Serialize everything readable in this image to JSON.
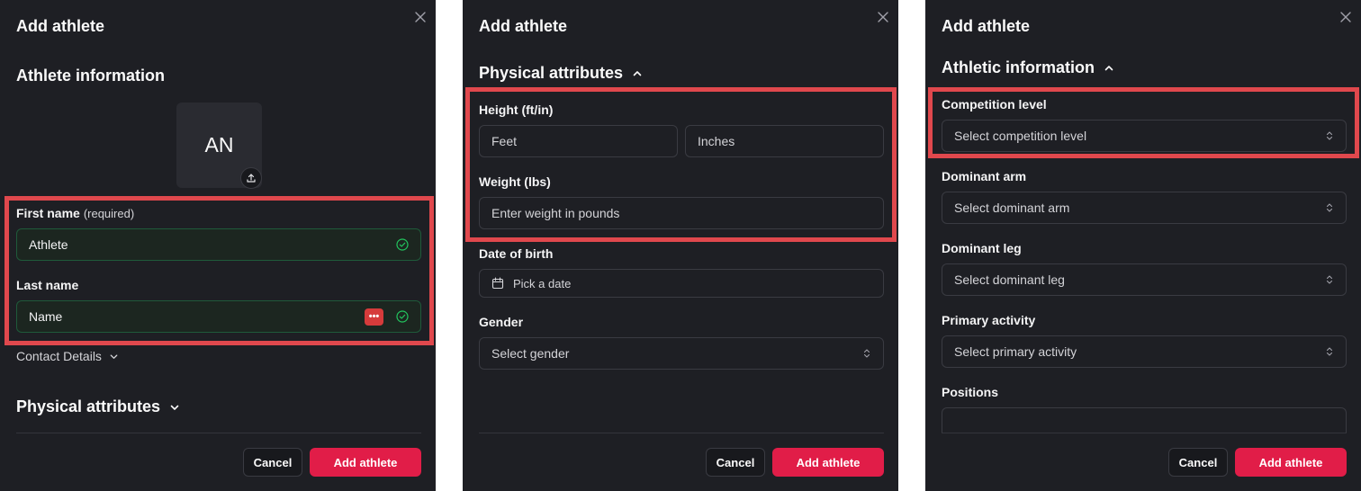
{
  "panels": [
    {
      "title": "Add athlete",
      "section": "Athlete information",
      "avatar_initials": "AN",
      "first_name_label": "First name",
      "first_name_required": "(required)",
      "first_name_value": "Athlete",
      "last_name_label": "Last name",
      "last_name_value": "Name",
      "password_manager_glyph": "•••",
      "contact_details": "Contact Details",
      "physical_section": "Physical attributes",
      "cancel": "Cancel",
      "submit": "Add athlete"
    },
    {
      "title": "Add athlete",
      "section": "Physical attributes",
      "height_label": "Height (ft/in)",
      "feet_placeholder": "Feet",
      "inches_placeholder": "Inches",
      "weight_label": "Weight (lbs)",
      "weight_placeholder": "Enter weight in pounds",
      "dob_label": "Date of birth",
      "dob_placeholder": "Pick a date",
      "gender_label": "Gender",
      "gender_placeholder": "Select gender",
      "cancel": "Cancel",
      "submit": "Add athlete"
    },
    {
      "title": "Add athlete",
      "section": "Athletic information",
      "competition_label": "Competition level",
      "competition_placeholder": "Select competition level",
      "arm_label": "Dominant arm",
      "arm_placeholder": "Select dominant arm",
      "leg_label": "Dominant leg",
      "leg_placeholder": "Select dominant leg",
      "activity_label": "Primary activity",
      "activity_placeholder": "Select primary activity",
      "positions_label": "Positions",
      "cancel": "Cancel",
      "submit": "Add athlete"
    }
  ],
  "colors": {
    "panel_bg": "#1e1f24",
    "accent": "#e11d48",
    "highlight": "#e0484d",
    "valid_border": "#1f5a3a",
    "valid_check": "#22c55e"
  },
  "icons": [
    "close-icon",
    "chevron-up-icon",
    "chevron-down-icon",
    "upload-icon",
    "check-circle-icon",
    "calendar-icon",
    "chevrons-up-down-icon",
    "password-manager-icon"
  ]
}
